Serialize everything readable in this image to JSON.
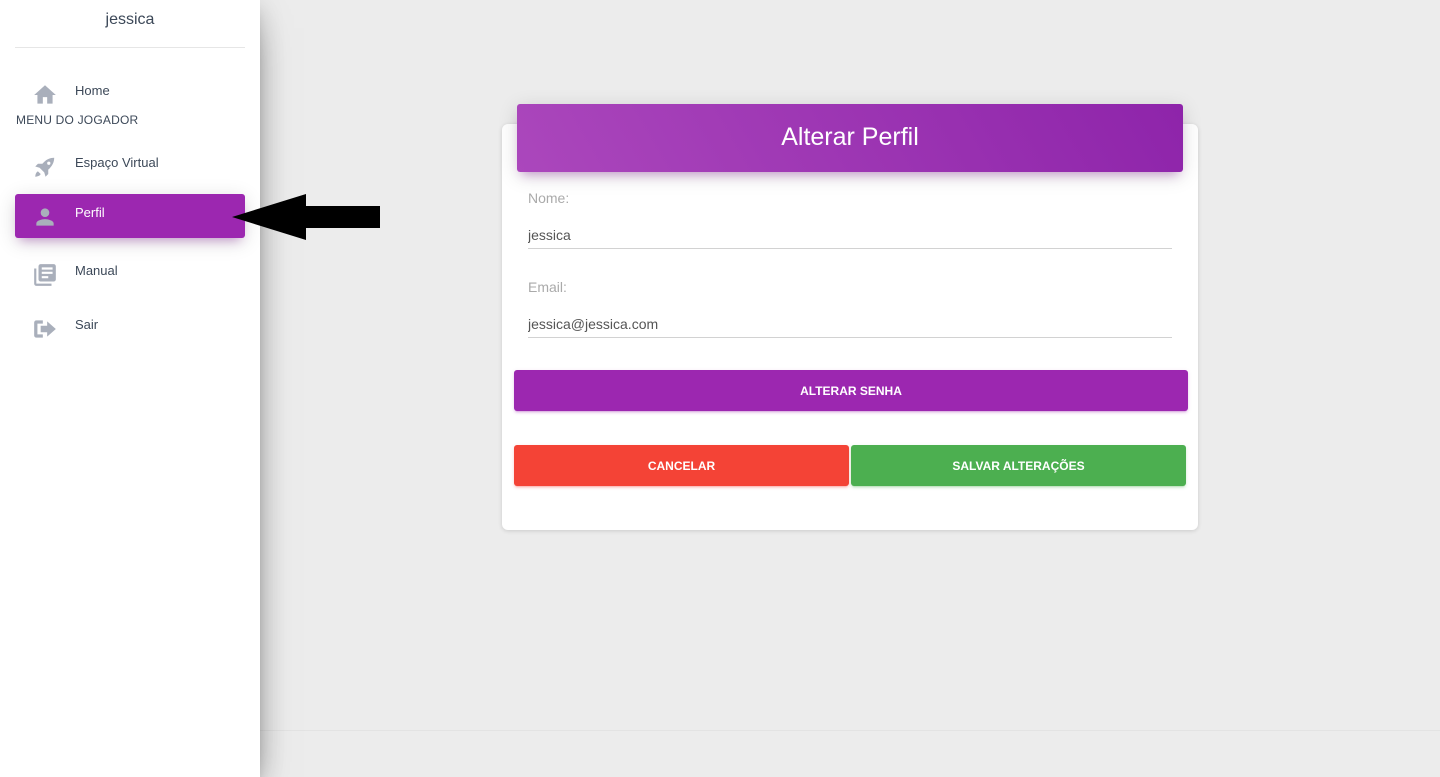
{
  "sidebar": {
    "user_name": "jessica",
    "section_label": "MENU DO JOGADOR",
    "items": [
      {
        "label": "Home",
        "icon": "home-icon"
      },
      {
        "label": "Espaço Virtual",
        "icon": "rocket-icon"
      },
      {
        "label": "Perfil",
        "icon": "person-icon",
        "active": true
      },
      {
        "label": "Manual",
        "icon": "library-books-icon"
      },
      {
        "label": "Sair",
        "icon": "logout-icon"
      }
    ]
  },
  "card": {
    "title": "Alterar Perfil",
    "fields": [
      {
        "label": "Nome:",
        "value": "jessica"
      },
      {
        "label": "Email:",
        "value": "jessica@jessica.com"
      }
    ],
    "buttons": {
      "change_password": "ALTERAR SENHA",
      "cancel": "CANCELAR",
      "save": "SALVAR ALTERAÇÕES"
    }
  },
  "colors": {
    "primary": "#9c27b0",
    "danger": "#f44336",
    "success": "#4caf50",
    "icon": "#a9afbb"
  }
}
